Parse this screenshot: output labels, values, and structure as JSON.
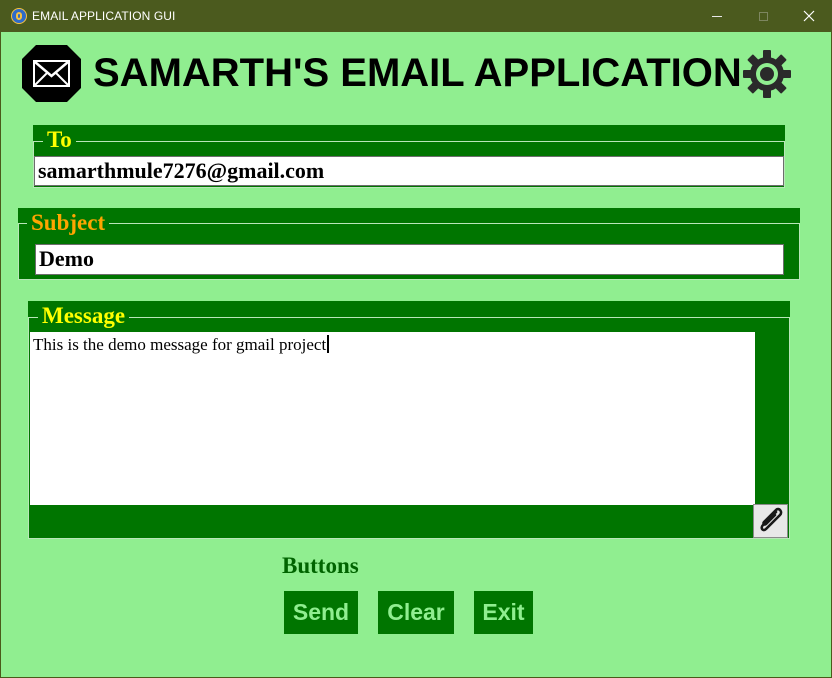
{
  "window": {
    "title": "EMAIL APPLICATION GUI",
    "controls": [
      "minimize",
      "maximize",
      "close"
    ]
  },
  "header": {
    "title": "SAMARTH'S EMAIL APPLICATION",
    "left_icon": "mail-icon",
    "right_icon": "gear-icon"
  },
  "to": {
    "label": "To",
    "value": "samarthmule7276@gmail.com"
  },
  "subject": {
    "label": "Subject",
    "value": "Demo"
  },
  "message": {
    "label": "Message",
    "value": "This is the demo message for gmail project",
    "attach_icon": "paperclip-icon"
  },
  "buttons": {
    "label": "Buttons",
    "send": "Send",
    "clear": "Clear",
    "exit": "Exit"
  },
  "colors": {
    "background": "#90ee90",
    "titlebar": "#4b5a1e",
    "frame": "#007500",
    "label_yellow": "#ffff00",
    "label_orange": "#ffa500",
    "buttons_label": "#006400",
    "button_text": "#90ee90"
  }
}
